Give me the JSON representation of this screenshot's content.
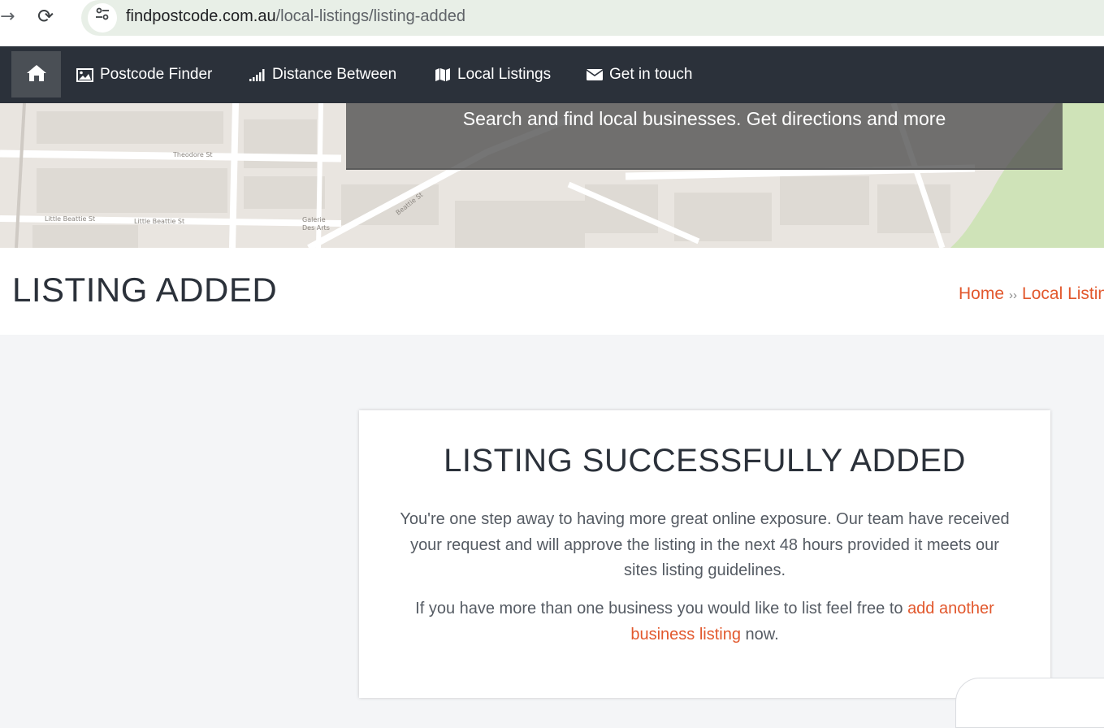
{
  "browser": {
    "url_domain": "findpostcode.com.au",
    "url_path": "/local-listings/listing-added"
  },
  "nav": {
    "home_icon": "home-icon",
    "items": [
      {
        "label": "Postcode Finder",
        "icon": "image-icon"
      },
      {
        "label": "Distance Between",
        "icon": "signal-icon"
      },
      {
        "label": "Local Listings",
        "icon": "map-icon"
      },
      {
        "label": "Get in touch",
        "icon": "envelope-icon"
      }
    ]
  },
  "hero": {
    "tagline": "Search and find local businesses. Get directions and more"
  },
  "page": {
    "title": "LISTING ADDED",
    "breadcrumb": {
      "home": "Home",
      "separator": "››",
      "current": "Local Listings"
    }
  },
  "card": {
    "heading": "LISTING SUCCESSFULLY ADDED",
    "paragraph1": "You're one step away to having more great online exposure. Our team have received your request and will approve the listing in the next 48 hours provided it meets our sites listing guidelines.",
    "paragraph2_before": "If you have more than one business you would like to list feel free to ",
    "paragraph2_link": "add another business listing",
    "paragraph2_after": " now."
  },
  "colors": {
    "navbar": "#2b313a",
    "accent_link": "#e2582d",
    "page_bg": "#f4f5f7"
  }
}
